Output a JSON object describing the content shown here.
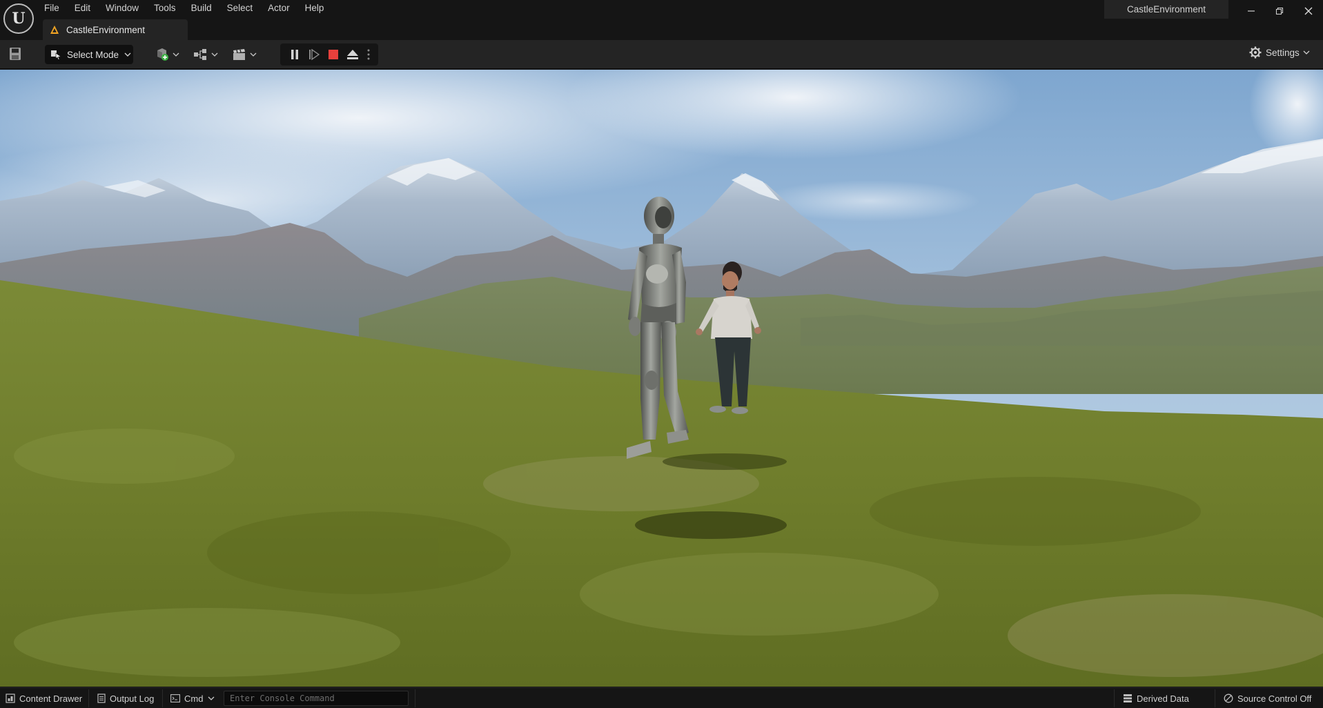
{
  "menu": [
    "File",
    "Edit",
    "Window",
    "Tools",
    "Build",
    "Select",
    "Actor",
    "Help"
  ],
  "document_tab": {
    "label": "CastleEnvironment",
    "icon": "level-warning-icon"
  },
  "project_name": "CastleEnvironment",
  "toolbar": {
    "select_mode": "Select Mode",
    "settings": "Settings"
  },
  "statusbar": {
    "content_drawer": "Content Drawer",
    "output_log": "Output Log",
    "cmd": "Cmd",
    "console_placeholder": "Enter Console Command",
    "derived_data": "Derived Data",
    "source_control": "Source Control Off"
  },
  "colors": {
    "accent_stop": "#e8403c",
    "bg_dark": "#151515",
    "bg_panel": "#242424"
  }
}
